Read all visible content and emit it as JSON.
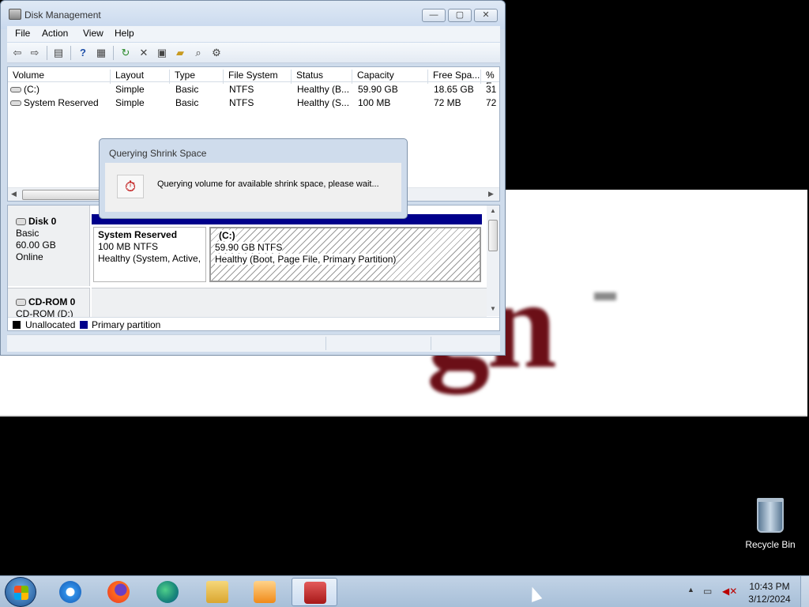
{
  "window": {
    "title": "Disk Management",
    "buttons": {
      "minimize": "—",
      "maximize": "▢",
      "close": "✕"
    }
  },
  "menu": [
    "File",
    "Action",
    "View",
    "Help"
  ],
  "toolbar": [
    "back-arrow-icon",
    "forward-arrow-icon",
    "console-tree-icon",
    "help-icon",
    "properties-icon",
    "refresh-icon",
    "delete-icon",
    "disk-icon",
    "open-icon",
    "search-icon",
    "settings-icon"
  ],
  "volumes": {
    "columns": [
      "Volume",
      "Layout",
      "Type",
      "File System",
      "Status",
      "Capacity",
      "Free Spa...",
      "% F"
    ],
    "rows": [
      [
        "(C:)",
        "Simple",
        "Basic",
        "NTFS",
        "Healthy (B...",
        "59.90 GB",
        "18.65 GB",
        "31"
      ],
      [
        "System Reserved",
        "Simple",
        "Basic",
        "NTFS",
        "Healthy (S...",
        "100 MB",
        "72 MB",
        "72"
      ]
    ]
  },
  "disks": [
    {
      "name": "Disk 0",
      "type": "Basic",
      "size": "60.00 GB",
      "state": "Online"
    },
    {
      "name": "CD-ROM 0",
      "type": "CD-ROM (D:)"
    }
  ],
  "partitions": [
    {
      "name": "System Reserved",
      "fs": "100 MB NTFS",
      "status": "Healthy (System, Active,"
    },
    {
      "name": "(C:)",
      "fs": "59.90 GB NTFS",
      "status": "Healthy (Boot, Page File, Primary Partition)"
    }
  ],
  "legend": [
    {
      "label": "Unallocated",
      "color": "#000000"
    },
    {
      "label": "Primary partition",
      "color": "#00008b"
    }
  ],
  "dialog": {
    "title": "Querying Shrink Space",
    "message": "Querying volume for available shrink space, please wait..."
  },
  "desktop": {
    "recycle_bin": "Recycle Bin",
    "wallpaper_text": "gn"
  },
  "taskbar": {
    "apps": [
      "internet-explorer-icon",
      "firefox-icon",
      "edge-icon",
      "file-explorer-icon",
      "media-player-icon",
      "toolbox-icon"
    ],
    "time": "10:43 PM",
    "date": "3/12/2024"
  }
}
